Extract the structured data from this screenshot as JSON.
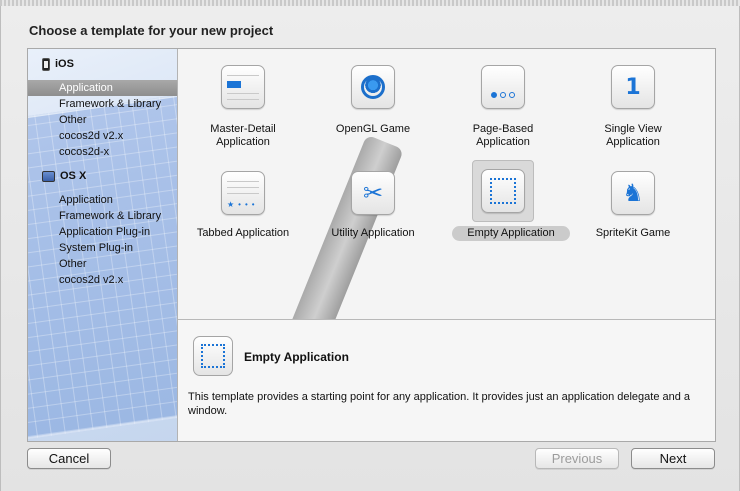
{
  "dialog": {
    "title": "Choose a template for your new project"
  },
  "sidebar": {
    "ios_header": "iOS",
    "ios_items": [
      "Application",
      "Framework & Library",
      "Other",
      "cocos2d v2.x",
      "cocos2d-x"
    ],
    "osx_header": "OS X",
    "osx_items": [
      "Application",
      "Framework & Library",
      "Application Plug-in",
      "System Plug-in",
      "Other",
      "cocos2d v2.x"
    ],
    "selected": "Application"
  },
  "templates": [
    {
      "label": "Master-Detail Application",
      "icon": "master-detail-icon"
    },
    {
      "label": "OpenGL Game",
      "icon": "opengl-icon"
    },
    {
      "label": "Page-Based Application",
      "icon": "page-based-icon"
    },
    {
      "label": "Single View Application",
      "icon": "single-view-icon"
    },
    {
      "label": "Tabbed Application",
      "icon": "tabbed-icon"
    },
    {
      "label": "Utility Application",
      "icon": "utility-icon"
    },
    {
      "label": "Empty Application",
      "icon": "empty-app-icon",
      "selected": true
    },
    {
      "label": "SpriteKit Game",
      "icon": "spritekit-icon"
    }
  ],
  "template_lines": {
    "master_1": "Master-Detail",
    "master_2": "Application",
    "page_1": "Page-Based",
    "page_2": "Application",
    "single_1": "Single View",
    "single_2": "Application",
    "one_glyph": "1"
  },
  "description": {
    "title": "Empty Application",
    "text": "This template provides a starting point for any application. It provides just an application delegate and a window."
  },
  "buttons": {
    "cancel": "Cancel",
    "previous": "Previous",
    "next": "Next"
  },
  "colors": {
    "accent": "#1b74d6",
    "selection": "#9a9a9a"
  }
}
